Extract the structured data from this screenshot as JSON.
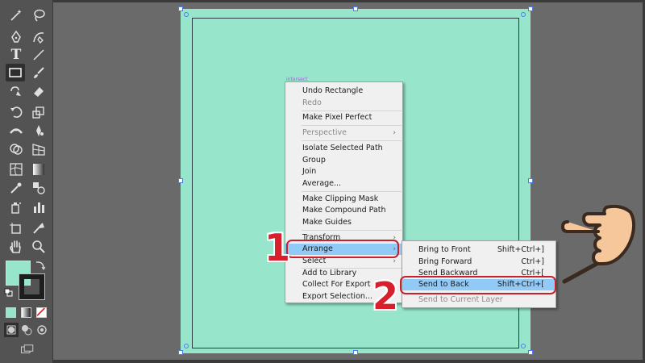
{
  "canvas": {
    "smart_guide_label": "intersect",
    "artboard_color": "#97e6cc"
  },
  "toolbar": {
    "type_tool_glyph": "T",
    "tools": [
      "magic-wand-icon",
      "lasso-icon",
      "pen-icon",
      "curvature-icon",
      "type-icon",
      "line-icon",
      "rectangle-icon",
      "paintbrush-icon",
      "shaper-icon",
      "eraser-icon",
      "rotate-icon",
      "scale-icon",
      "width-icon",
      "puppet-warp-icon",
      "shape-builder-icon",
      "perspective-grid-icon",
      "mesh-icon",
      "gradient-icon",
      "eyedropper-icon",
      "blend-icon",
      "symbol-sprayer-icon",
      "column-graph-icon",
      "artboard-icon",
      "slice-icon",
      "hand-icon",
      "zoom-icon"
    ],
    "fill_color": "#97e6cc",
    "stroke_color": "#1e1e1e"
  },
  "context_menu": {
    "items": [
      {
        "label": "Undo Rectangle",
        "disabled": false
      },
      {
        "label": "Redo",
        "disabled": true
      },
      {
        "label": "Make Pixel Perfect",
        "disabled": false
      },
      {
        "label": "Perspective",
        "disabled": true,
        "submenu": true
      },
      {
        "label": "Isolate Selected Path",
        "disabled": false
      },
      {
        "label": "Group",
        "disabled": false
      },
      {
        "label": "Join",
        "disabled": false
      },
      {
        "label": "Average...",
        "disabled": false
      },
      {
        "label": "Make Clipping Mask",
        "disabled": false
      },
      {
        "label": "Make Compound Path",
        "disabled": false
      },
      {
        "label": "Make Guides",
        "disabled": false
      },
      {
        "label": "Transform",
        "disabled": false,
        "submenu": true
      },
      {
        "label": "Arrange",
        "disabled": false,
        "submenu": true,
        "highlighted": true
      },
      {
        "label": "Select",
        "disabled": false,
        "submenu": true
      },
      {
        "label": "Add to Library",
        "disabled": false
      },
      {
        "label": "Collect For Export",
        "disabled": false,
        "submenu": true
      },
      {
        "label": "Export Selection...",
        "disabled": false
      }
    ],
    "submenu_arrow": "›"
  },
  "arrange_submenu": {
    "items": [
      {
        "label": "Bring to Front",
        "shortcut": "Shift+Ctrl+]",
        "disabled": false
      },
      {
        "label": "Bring Forward",
        "shortcut": "Ctrl+]",
        "disabled": false
      },
      {
        "label": "Send Backward",
        "shortcut": "Ctrl+[",
        "disabled": false
      },
      {
        "label": "Send to Back",
        "shortcut": "Shift+Ctrl+[",
        "disabled": false,
        "highlighted": true
      },
      {
        "label": "Send to Current Layer",
        "shortcut": "",
        "disabled": true
      }
    ]
  },
  "annotations": {
    "step1": "1",
    "step2": "2",
    "accent": "#c8202d"
  }
}
